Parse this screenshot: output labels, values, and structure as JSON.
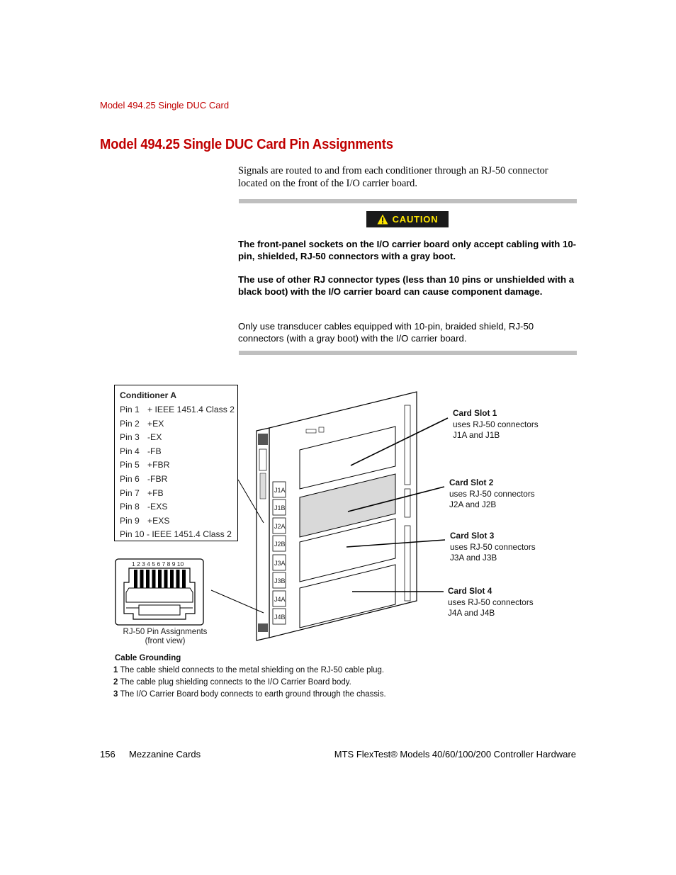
{
  "header": {
    "running_head": "Model 494.25 Single DUC Card",
    "title": "Model 494.25 Single DUC Card Pin Assignments"
  },
  "intro": "Signals are routed to and from each conditioner through an RJ-50 connector located on the front of the I/O carrier board.",
  "caution": {
    "icon": "warning-triangle-icon",
    "label": "CAUTION",
    "badge_color": "#1a1a1a",
    "label_color": "#ffe600",
    "paragraphs": [
      "The front-panel sockets on the I/O carrier board only accept cabling with 10-pin, shielded, RJ-50 connectors with a gray boot.",
      "The use of other RJ connector types (less than 10 pins or unshielded with a black boot) with the I/O carrier board can cause component damage."
    ],
    "note": "Only use transducer cables equipped with 10-pin, braided shield, RJ-50 connectors (with a gray boot) with the I/O carrier board."
  },
  "figure": {
    "pin_table": {
      "title": "Conditioner A",
      "rows": [
        {
          "pin": "Pin 1",
          "signal": "+ IEEE 1451.4 Class 2"
        },
        {
          "pin": "Pin 2",
          "signal": "+EX"
        },
        {
          "pin": "Pin 3",
          "signal": "-EX"
        },
        {
          "pin": "Pin 4",
          "signal": "-FB"
        },
        {
          "pin": "Pin 5",
          "signal": "+FBR"
        },
        {
          "pin": "Pin 6",
          "signal": "-FBR"
        },
        {
          "pin": "Pin 7",
          "signal": "+FB"
        },
        {
          "pin": "Pin 8",
          "signal": "-EXS"
        },
        {
          "pin": "Pin 9",
          "signal": "+EXS"
        },
        {
          "pin": "Pin 10",
          "signal": "- IEEE 1451.4 Class 2"
        }
      ]
    },
    "rj50": {
      "pin_numbers": "1 2 3 4 5 6 7 8 9 10",
      "caption_line1": "RJ-50 Pin Assignments",
      "caption_line2": "(front view)"
    },
    "connectors": [
      "J1A",
      "J1B",
      "J2A",
      "J2B",
      "J3A",
      "J3B",
      "J4A",
      "J4B"
    ],
    "card_slots": [
      {
        "title": "Card Slot 1",
        "line1": "uses RJ-50 connectors",
        "line2": "J1A and J1B"
      },
      {
        "title": "Card Slot 2",
        "line1": "uses RJ-50 connectors",
        "line2": "J2A and J2B"
      },
      {
        "title": "Card Slot 3",
        "line1": "uses RJ-50 connectors",
        "line2": "J3A and J3B"
      },
      {
        "title": "Card Slot 4",
        "line1": "uses RJ-50 connectors",
        "line2": "J4A and J4B"
      }
    ],
    "grounding": {
      "title": "Cable Grounding",
      "items": [
        {
          "num": "1",
          "text": "The cable shield connects to the metal shielding on the RJ-50 cable plug."
        },
        {
          "num": "2",
          "text": "The cable plug shielding connects to the I/O Carrier Board body."
        },
        {
          "num": "3",
          "text": "The I/O Carrier Board body connects to earth ground through the chassis."
        }
      ]
    }
  },
  "footer": {
    "page_number": "156",
    "section": "Mezzanine Cards",
    "book_title": "MTS FlexTest® Models 40/60/100/200 Controller Hardware"
  }
}
